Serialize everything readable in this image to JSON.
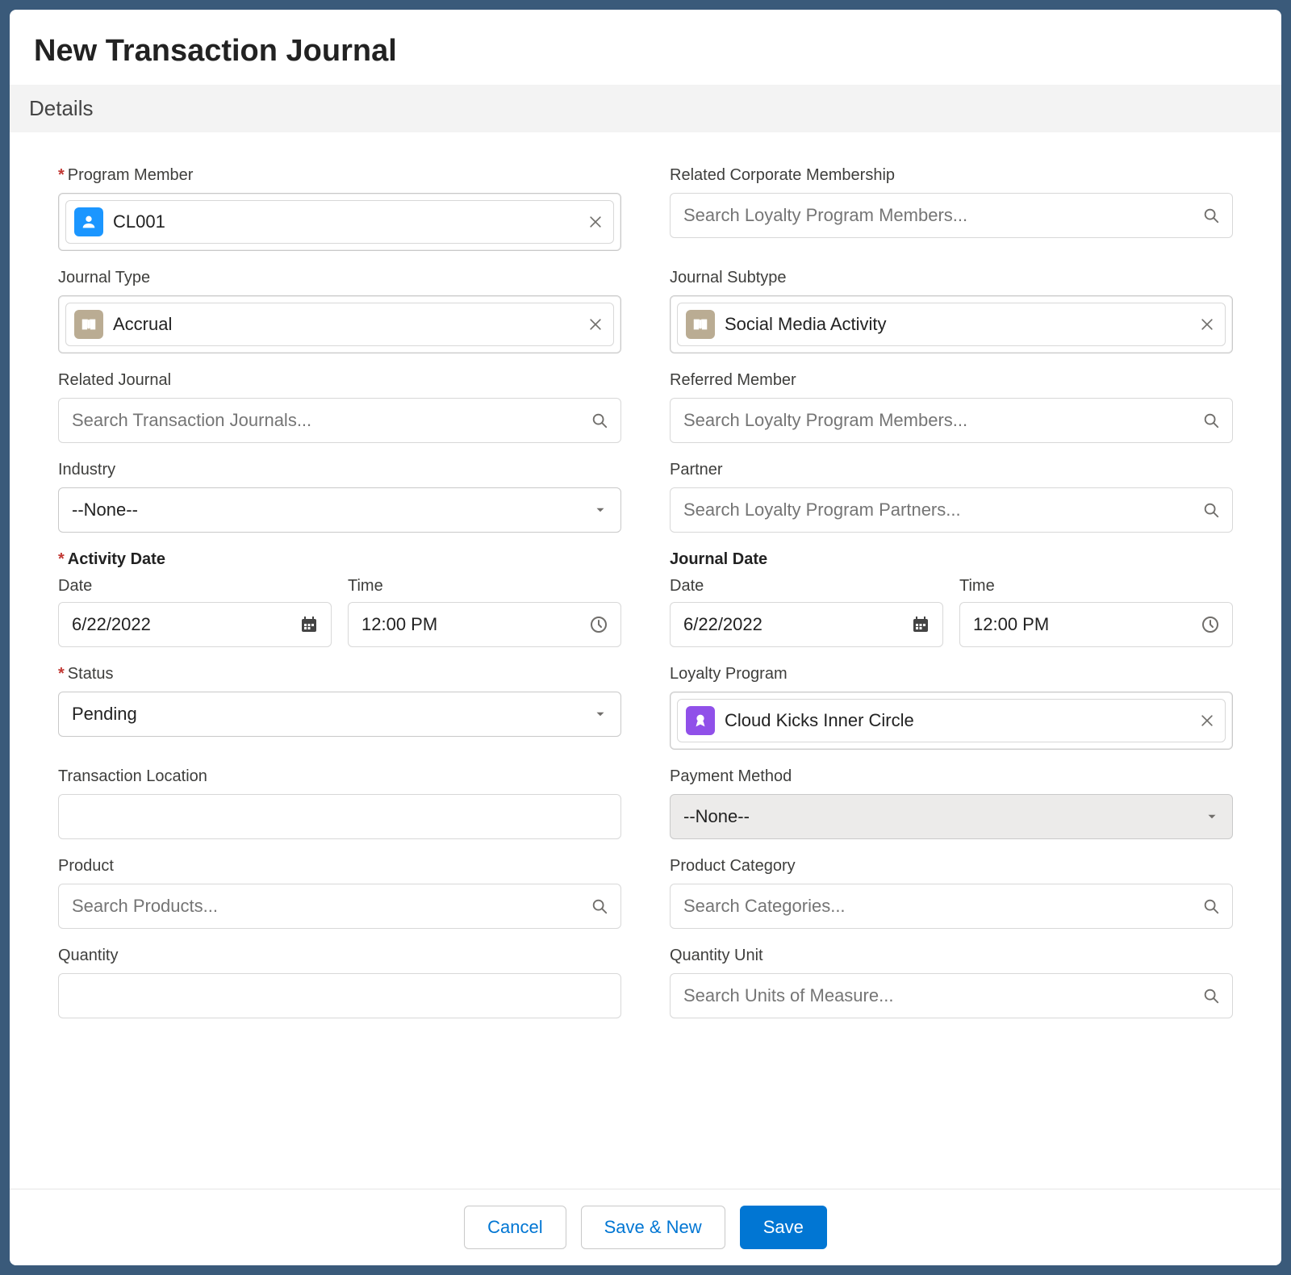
{
  "modal": {
    "title": "New Transaction Journal"
  },
  "section": {
    "details": "Details"
  },
  "labels": {
    "program_member": "Program Member",
    "related_corporate_membership": "Related Corporate Membership",
    "journal_type": "Journal Type",
    "journal_subtype": "Journal Subtype",
    "related_journal": "Related Journal",
    "referred_member": "Referred Member",
    "industry": "Industry",
    "partner": "Partner",
    "activity_date": "Activity Date",
    "journal_date": "Journal Date",
    "date": "Date",
    "time": "Time",
    "status": "Status",
    "loyalty_program": "Loyalty Program",
    "transaction_location": "Transaction Location",
    "payment_method": "Payment Method",
    "product": "Product",
    "product_category": "Product Category",
    "quantity": "Quantity",
    "quantity_unit": "Quantity Unit"
  },
  "values": {
    "program_member": "CL001",
    "journal_type": "Accrual",
    "journal_subtype": "Social Media Activity",
    "industry": "--None--",
    "activity_date": "6/22/2022",
    "activity_time": "12:00 PM",
    "journal_date": "6/22/2022",
    "journal_time": "12:00 PM",
    "status": "Pending",
    "loyalty_program": "Cloud Kicks Inner Circle",
    "payment_method": "--None--"
  },
  "placeholders": {
    "loyalty_members": "Search Loyalty Program Members...",
    "transaction_journals": "Search Transaction Journals...",
    "loyalty_partners": "Search Loyalty Program Partners...",
    "products": "Search Products...",
    "categories": "Search Categories...",
    "units": "Search Units of Measure..."
  },
  "buttons": {
    "cancel": "Cancel",
    "save_new": "Save & New",
    "save": "Save"
  }
}
